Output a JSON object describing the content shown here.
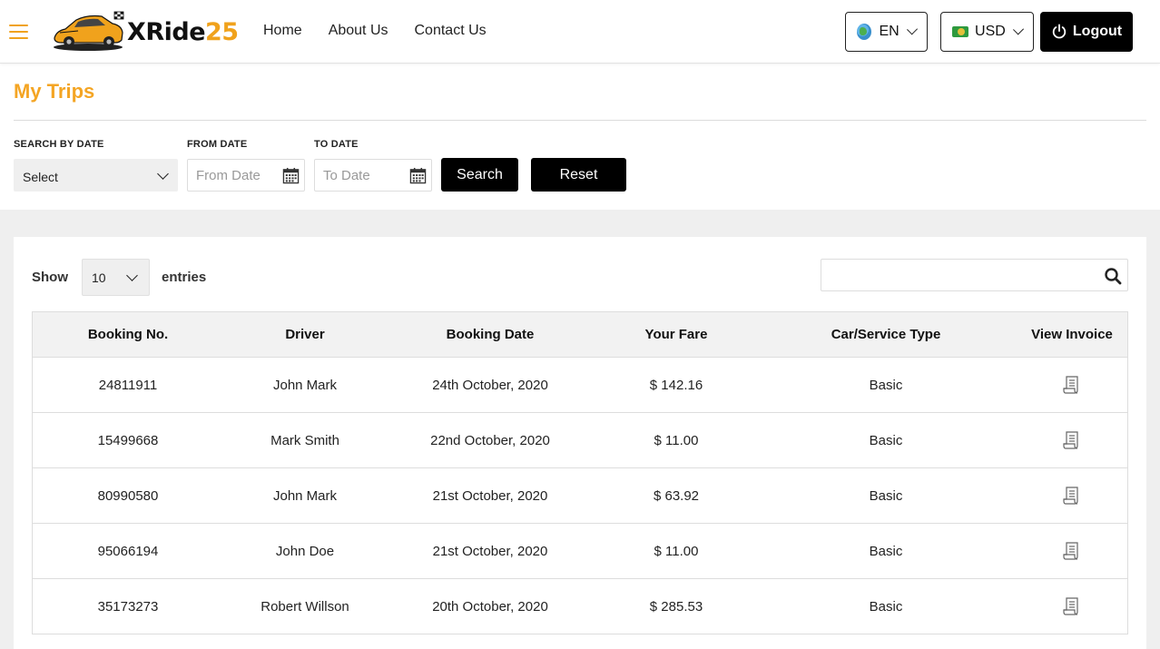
{
  "header": {
    "logo_part1": "XRide",
    "logo_part2": "25",
    "nav": [
      "Home",
      "About Us",
      "Contact Us"
    ],
    "language": "EN",
    "currency": "USD",
    "logout_label": "Logout"
  },
  "page": {
    "title": "My Trips"
  },
  "filters": {
    "search_by_date_label": "SEARCH BY DATE",
    "search_by_date_value": "Select",
    "from_date_label": "FROM DATE",
    "from_date_placeholder": "From Date",
    "to_date_label": "TO DATE",
    "to_date_placeholder": "To Date",
    "search_label": "Search",
    "reset_label": "Reset"
  },
  "table_controls": {
    "show_label": "Show",
    "entries_value": "10",
    "entries_label": "entries"
  },
  "table": {
    "columns": [
      "Booking No.",
      "Driver",
      "Booking Date",
      "Your Fare",
      "Car/Service Type",
      "View Invoice"
    ],
    "rows": [
      {
        "booking_no": "24811911",
        "driver": "John Mark",
        "date": "24th October, 2020",
        "fare": "$ 142.16",
        "type": "Basic"
      },
      {
        "booking_no": "15499668",
        "driver": "Mark Smith",
        "date": "22nd October, 2020",
        "fare": "$ 11.00",
        "type": "Basic"
      },
      {
        "booking_no": "80990580",
        "driver": "John Mark",
        "date": "21st October, 2020",
        "fare": "$ 63.92",
        "type": "Basic"
      },
      {
        "booking_no": "95066194",
        "driver": "John Doe",
        "date": "21st October, 2020",
        "fare": "$ 11.00",
        "type": "Basic"
      },
      {
        "booking_no": "35173273",
        "driver": "Robert Willson",
        "date": "20th October, 2020",
        "fare": "$ 285.53",
        "type": "Basic"
      }
    ]
  },
  "colors": {
    "accent": "#f4a524",
    "button": "#000000",
    "grey_bg": "#efefef"
  },
  "icons": {
    "menu": "hamburger-menu-icon",
    "language": "globe-icon",
    "currency": "money-bill-icon",
    "logout": "power-icon",
    "calendar": "calendar-icon",
    "search": "search-icon",
    "invoice": "invoice-receipt-icon"
  }
}
